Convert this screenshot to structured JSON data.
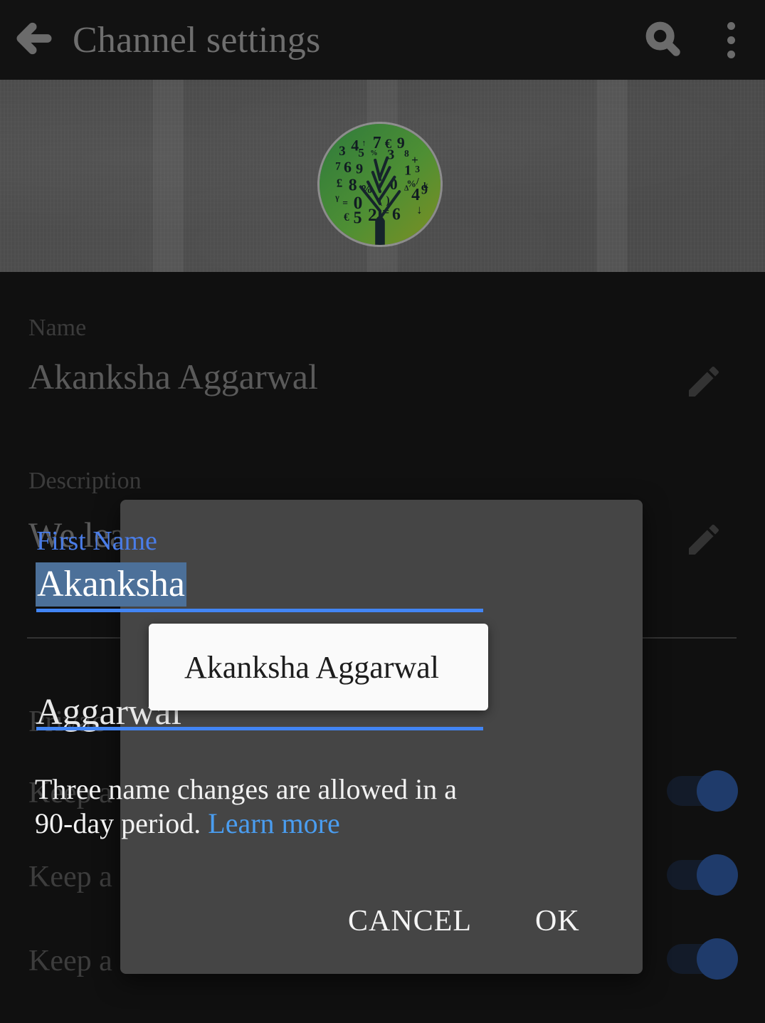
{
  "appbar": {
    "back_icon": "arrow-back-icon",
    "title": "Channel settings",
    "search_icon": "search-icon",
    "overflow_icon": "more-vert-icon"
  },
  "banner": {
    "avatar_alt": "channel-avatar-number-tree"
  },
  "settings": {
    "name_field": {
      "label": "Name",
      "value": "Akanksha Aggarwal",
      "edit_icon": "pencil-edit-icon"
    },
    "description_field": {
      "label": "Description",
      "value": "We lea",
      "edit_icon": "pencil-edit-icon"
    },
    "privacy_label": "Privac",
    "rows": [
      {
        "label": "Keep a",
        "toggle_on": true
      },
      {
        "label": "Keep a",
        "toggle_on": true
      },
      {
        "label": "Keep a",
        "toggle_on": true
      }
    ]
  },
  "dialog": {
    "first_name_label": "First Name",
    "first_name_value": "Akanksha",
    "last_name_value": "Aggarwal",
    "suggestion": "Akanksha Aggarwal",
    "note_text": "Three name changes are allowed in a 90-day period. ",
    "note_link": "Learn more",
    "cancel_label": "CANCEL",
    "ok_label": "OK"
  },
  "colors": {
    "accent_blue": "#4285f4",
    "label_blue": "#4a7de8",
    "link_blue": "#4a9df0",
    "selection_blue": "#4c7099",
    "dialog_bg": "#454545",
    "toggle_thumb": "#1f3b6b",
    "toggle_track": "#131b29"
  }
}
